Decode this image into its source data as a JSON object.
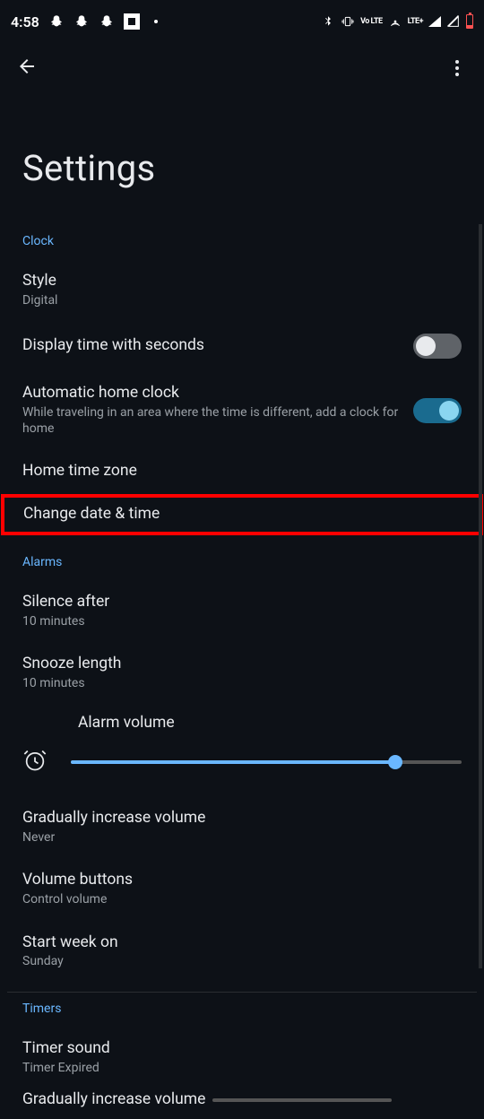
{
  "statusbar": {
    "time": "4:58",
    "lte": "LTE+",
    "volte": "Vo LTE"
  },
  "page": {
    "title": "Settings"
  },
  "sections": {
    "clock": {
      "header": "Clock",
      "style": {
        "title": "Style",
        "value": "Digital"
      },
      "seconds": {
        "title": "Display time with seconds"
      },
      "autohome": {
        "title": "Automatic home clock",
        "subtitle": "While traveling in an area where the time is different, add a clock for home"
      },
      "hometz": {
        "title": "Home time zone"
      },
      "changedt": {
        "title": "Change date & time"
      }
    },
    "alarms": {
      "header": "Alarms",
      "silence": {
        "title": "Silence after",
        "value": "10 minutes"
      },
      "snooze": {
        "title": "Snooze length",
        "value": "10 minutes"
      },
      "volume": {
        "label": "Alarm volume",
        "percent": 83
      },
      "gradual": {
        "title": "Gradually increase volume",
        "value": "Never"
      },
      "volbtn": {
        "title": "Volume buttons",
        "value": "Control volume"
      },
      "week": {
        "title": "Start week on",
        "value": "Sunday"
      }
    },
    "timers": {
      "header": "Timers",
      "sound": {
        "title": "Timer sound",
        "value": "Timer Expired"
      },
      "gradual": {
        "title": "Gradually increase volume"
      }
    }
  }
}
